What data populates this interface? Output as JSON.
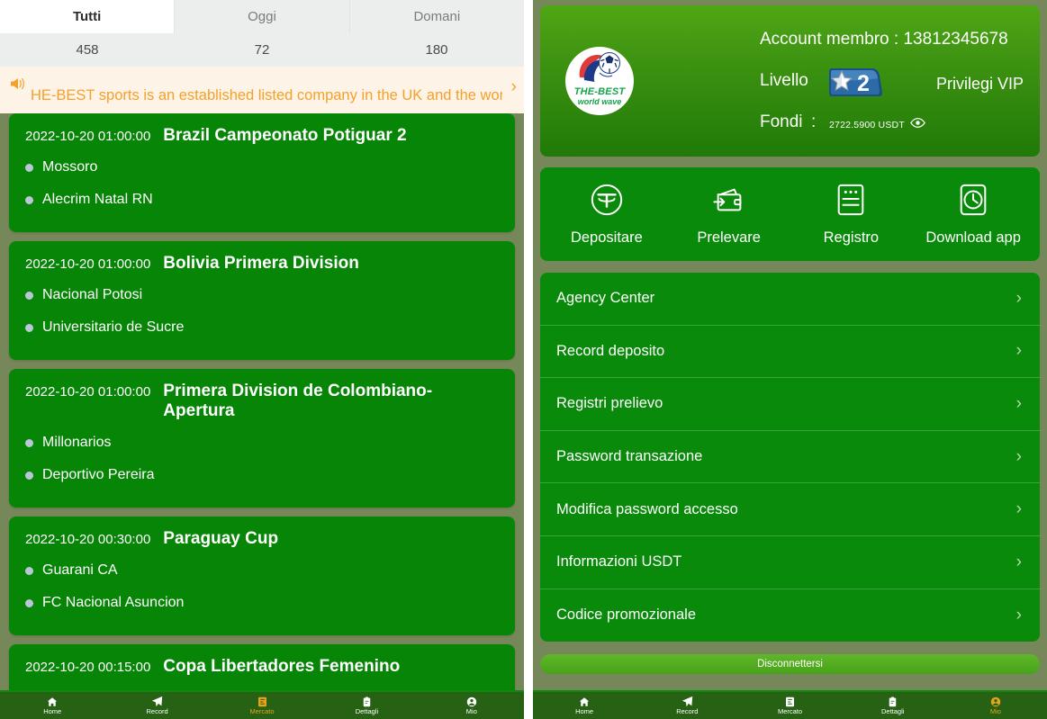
{
  "left": {
    "tabs": [
      {
        "label": "Tutti",
        "count": "458",
        "active": true
      },
      {
        "label": "Oggi",
        "count": "72",
        "active": false
      },
      {
        "label": "Domani",
        "count": "180",
        "active": false
      }
    ],
    "announcement": {
      "icon": "speaker-icon",
      "text": "HE-BEST sports is an established listed company in the UK and the wor",
      "arrow": "›",
      "color": "#f5a02a",
      "background": "#fdf3e6"
    },
    "matches": [
      {
        "time": "2022-10-20 01:00:00",
        "league": "Brazil Campeonato Potiguar 2",
        "teams": [
          "Mossoro",
          "Alecrim Natal RN"
        ]
      },
      {
        "time": "2022-10-20 01:00:00",
        "league": "Bolivia Primera Division",
        "teams": [
          "Nacional Potosi",
          "Universitario de Sucre"
        ]
      },
      {
        "time": "2022-10-20 01:00:00",
        "league": "Primera Division de Colombiano-Apertura",
        "teams": [
          "Millonarios",
          "Deportivo Pereira"
        ]
      },
      {
        "time": "2022-10-20 00:30:00",
        "league": "Paraguay Cup",
        "teams": [
          "Guarani CA",
          "FC Nacional Asuncion"
        ]
      },
      {
        "time": "2022-10-20 00:15:00",
        "league": "Copa Libertadores Femenino",
        "teams": []
      }
    ],
    "bottom_nav": [
      {
        "label": "Home",
        "icon": "home-icon",
        "active": false
      },
      {
        "label": "Record",
        "icon": "paper-plane-icon",
        "active": false
      },
      {
        "label": "Mercato",
        "icon": "market-icon",
        "active": true
      },
      {
        "label": "Dettagli",
        "icon": "clipboard-icon",
        "active": false
      },
      {
        "label": "Mio",
        "icon": "user-circle-icon",
        "active": false
      }
    ]
  },
  "right": {
    "account": {
      "logo_title": "THE-BEST",
      "logo_subtitle": "world wave",
      "member_label": "Account membro : 13812345678",
      "level_label": "Livello",
      "level_value": "2",
      "vip_label": "Privilegi VIP",
      "funds_label": "Fondi :",
      "funds_value": "2722.5900 USDT",
      "eye_icon": "eye-icon"
    },
    "actions": [
      {
        "label": "Depositare",
        "icon": "tether-icon"
      },
      {
        "label": "Prelevare",
        "icon": "wallet-withdraw-icon"
      },
      {
        "label": "Registro",
        "icon": "record-book-icon"
      },
      {
        "label": "Download app",
        "icon": "clock-download-icon"
      }
    ],
    "menu": [
      {
        "label": "Agency Center"
      },
      {
        "label": "Record deposito"
      },
      {
        "label": "Registri prelievo"
      },
      {
        "label": "Password transazione"
      },
      {
        "label": "Modifica password accesso"
      },
      {
        "label": "Informazioni USDT"
      },
      {
        "label": "Codice promozionale"
      }
    ],
    "menu_chevron": "›",
    "logout_label": "Disconnettersi",
    "bottom_nav": [
      {
        "label": "Home",
        "icon": "home-icon",
        "active": false
      },
      {
        "label": "Record",
        "icon": "paper-plane-icon",
        "active": false
      },
      {
        "label": "Mercato",
        "icon": "market-icon",
        "active": false
      },
      {
        "label": "Dettagli",
        "icon": "clipboard-icon",
        "active": false
      },
      {
        "label": "Mio",
        "icon": "user-circle-icon",
        "active": true
      }
    ]
  },
  "theme": {
    "page_background": "#76875a",
    "card_green": "#078507",
    "panel_green": "#0a8a0a",
    "accent_orange": "#e8a31c",
    "nav_background": "#266114"
  }
}
